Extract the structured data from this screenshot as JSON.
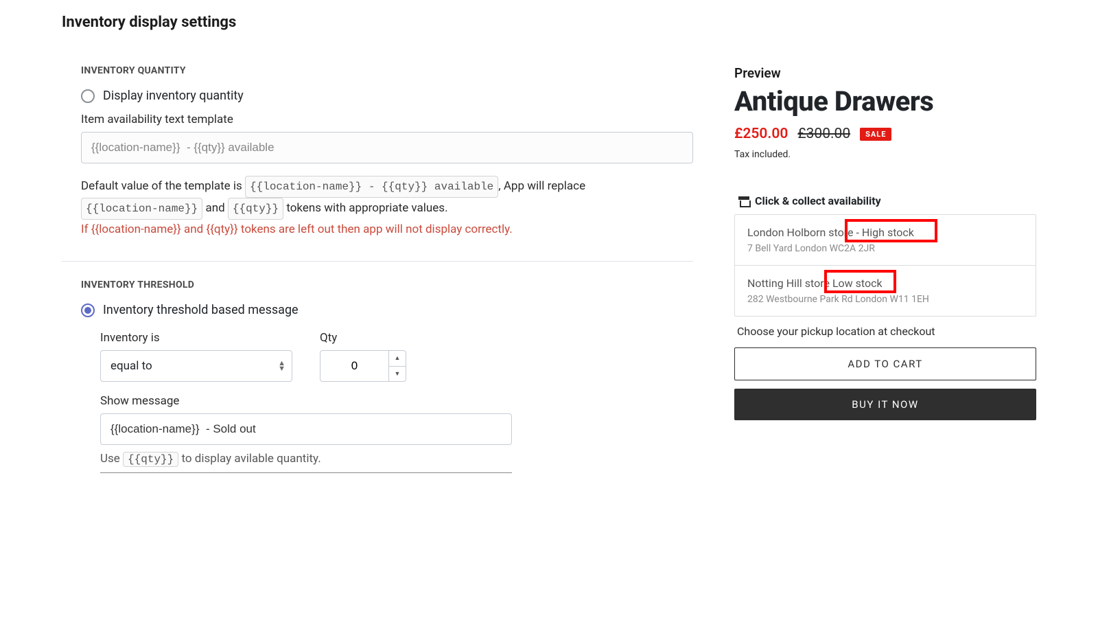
{
  "page": {
    "title": "Inventory display settings"
  },
  "section_qty": {
    "label": "INVENTORY QUANTITY",
    "radio_label": "Display inventory quantity",
    "template_label": "Item availability text template",
    "template_value": "{{location-name}}  - {{qty}} available",
    "help_lead": "Default value of the template is ",
    "token_full": "{{location-name}} - {{qty}} available",
    "help_mid1": ", App will replace ",
    "token_loc": "{{location-name}}",
    "help_and": " and ",
    "token_qty": "{{qty}}",
    "help_mid2": " tokens with appropriate values.",
    "help_warn": "If {{location-name}} and {{qty}} tokens are left out then app will not display correctly."
  },
  "section_th": {
    "label": "INVENTORY THRESHOLD",
    "radio_label": "Inventory threshold based message",
    "inv_label": "Inventory is",
    "inv_value": "equal to",
    "qty_label": "Qty",
    "qty_value": "0",
    "msg_label": "Show message",
    "msg_value": "{{location-name}}  - Sold out",
    "hint_prefix": "Use ",
    "hint_token": "{{qty}}",
    "hint_suffix": " to display avilable quantity."
  },
  "preview": {
    "label": "Preview",
    "product": "Antique Drawers",
    "price_sale": "£250.00",
    "price_orig": "£300.00",
    "sale_badge": "SALE",
    "tax": "Tax included.",
    "cc_header": "Click & collect availability",
    "locations": [
      {
        "name": "London Holborn store",
        "status": " - High stock",
        "addr": "7 Bell Yard London WC2A 2JR"
      },
      {
        "name": "Notting Hill store",
        "status": "  Low stock",
        "addr": "282 Westbourne Park Rd London W11 1EH"
      }
    ],
    "pickup_note": "Choose your pickup location at checkout",
    "add_to_cart": "ADD TO CART",
    "buy_now": "BUY IT NOW"
  }
}
